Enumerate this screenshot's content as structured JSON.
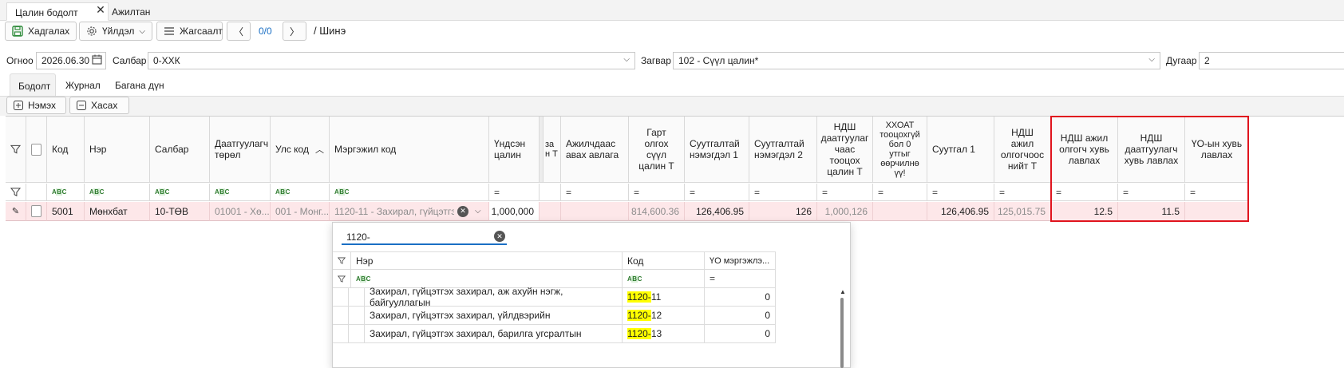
{
  "tabs": [
    {
      "label": "Цалин бодолт",
      "active": true
    },
    {
      "label": "Ажилтан",
      "active": false
    }
  ],
  "toolbar": {
    "save_label": "Хадгалах",
    "action_label": "Үйлдэл",
    "print_label": "Жагсаалт",
    "pager": "0/0",
    "breadcrumb": "/ Шинэ"
  },
  "form": {
    "date_label": "Огноо",
    "date_value": "2026.06.30",
    "branch_label": "Салбар",
    "branch_value": "0-ХХК",
    "template_label": "Загвар",
    "template_value": "102 - Сүүл цалин*",
    "number_label": "Дугаар",
    "number_value": "2"
  },
  "subtabs": [
    {
      "label": "Бодолт",
      "active": true
    },
    {
      "label": "Журнал",
      "active": false
    },
    {
      "label": "Багана дүн",
      "active": false
    }
  ],
  "grid_toolbar": {
    "add_label": "Нэмэх",
    "remove_label": "Хасах"
  },
  "grid": {
    "headers": {
      "code": "Код",
      "name": "Нэр",
      "branch": "Салбар",
      "payer_type": "Даатгуулагч төрөл",
      "country": "Улс код",
      "profession": "Мэргэжил код",
      "base_salary": "Үндсэн цалин",
      "partial": "за н Т",
      "employee_recv": "Ажилчдаас авах авлага",
      "take_home": "Гарт олгох сүүл цалин Т",
      "social_add1": "Суутгалтай нэмэгдэл 1",
      "social_add2": "Суутгалтай нэмэгдэл 2",
      "vat_exceed": "НДШ даатгуулаг чаас тооцох цалин Т",
      "pit_zero": "ХХОАТ тооцохгүй бол 0 утгыг өөрчилнө үү!",
      "deduction1": "Суутгал 1",
      "employer_total": "НДШ ажил олгогчоос нийт Т",
      "employer_rate": "НДШ ажил олгогч хувь лавлах",
      "insured_rate": "НДШ даатгуулагч хувь лавлах",
      "yo_rate": "ҮО-ын хувь лавлах"
    },
    "row": {
      "code": "5001",
      "name": "Мөнхбат",
      "branch": "10-ТӨВ",
      "payer_type": "01001 - Хө...",
      "country": "001 - Монг...",
      "profession": "1120-11 - Захирал, гүйцэтгэ...",
      "base_salary": "1,000,000",
      "take_home": "814,600.36",
      "social_add1": "126,406.95",
      "social_add2": "126",
      "vat_exceed": "1,000,126",
      "deduction1": "126,406.95",
      "employer_total": "125,015.75",
      "employer_rate": "12.5",
      "insured_rate": "11.5"
    }
  },
  "popup": {
    "search_value": "1120-",
    "headers": {
      "name": "Нэр",
      "code": "Код",
      "yo": "ҮО мэргэжлэ..."
    },
    "rows": [
      {
        "name": "Захирал, гүйцэтгэх захирал, аж ахуйн нэгж, байгууллагын",
        "code_prefix": "1120-",
        "code_suffix": "11",
        "yo": "0"
      },
      {
        "name": "Захирал, гүйцэтгэх захирал, үйлдвэрийн",
        "code_prefix": "1120-",
        "code_suffix": "12",
        "yo": "0"
      },
      {
        "name": "Захирал, гүйцэтгэх захирал, барилга угсралтын",
        "code_prefix": "1120-",
        "code_suffix": "13",
        "yo": "0"
      }
    ]
  },
  "colors": {
    "accent": "#1a6fc4",
    "row_highlight": "#fde7e9",
    "red_frame": "#e0141e",
    "search_hit": "#ffff00"
  }
}
